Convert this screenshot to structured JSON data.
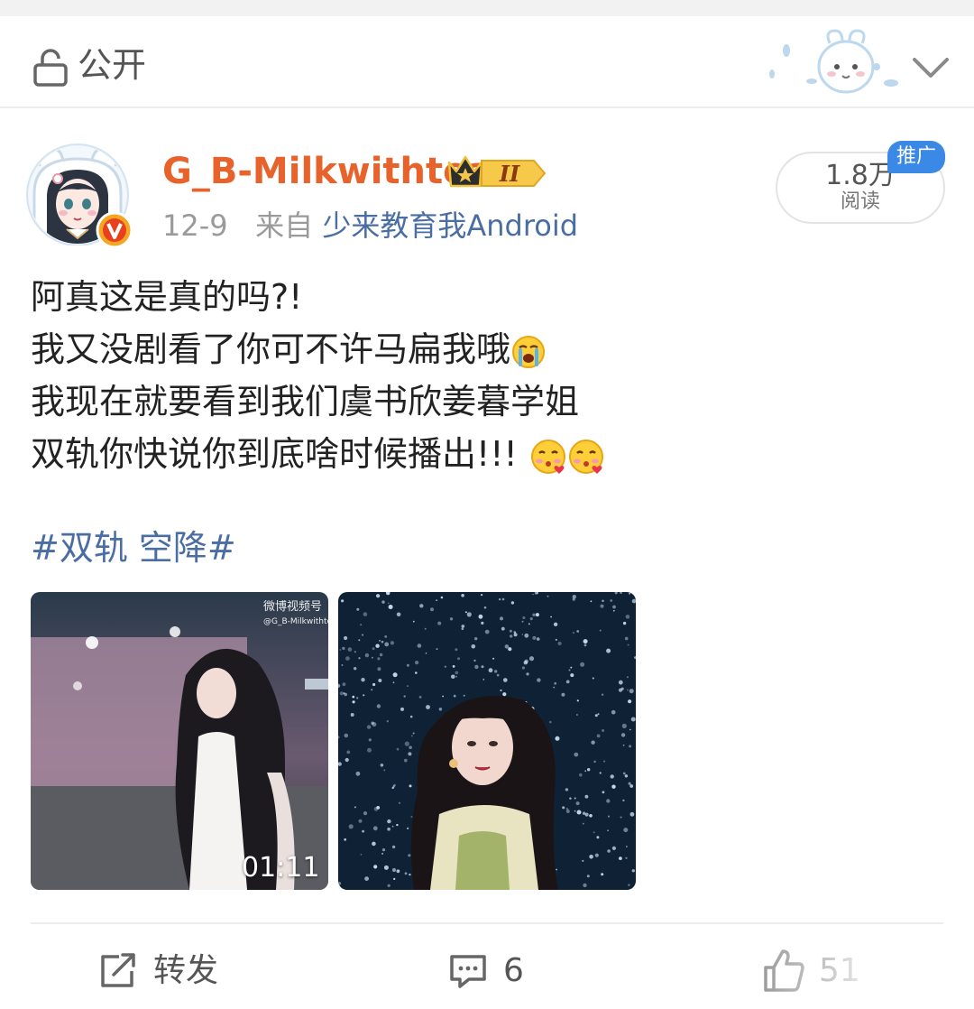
{
  "header": {
    "visibility_label": "公开",
    "icons": [
      "lock-icon",
      "decorative-bunny-sticker",
      "chevron-down-icon"
    ]
  },
  "post": {
    "username": "G_B-Milkwithtea",
    "level_badge": "II",
    "date": "12-9",
    "source_prefix": "来自",
    "source": "少来教育我Android",
    "reads_count": "1.8万",
    "reads_label": "阅读",
    "promo_badge": "推广",
    "text_lines": [
      "阿真这是真的吗?!",
      "我又没剧看了你可不许马扁我哦",
      "我现在就要看到我们虞书欣姜暮学姐",
      "双轨你快说你到底啥时候播出!!!"
    ],
    "hashtag": "#双轨 空降#",
    "media": [
      {
        "type": "video",
        "watermark": "微博视频号",
        "watermark_user": "@G_B-Milkwithtea",
        "duration": "01:11"
      },
      {
        "type": "image"
      }
    ]
  },
  "actions": {
    "repost_label": "转发",
    "comment_count": "6",
    "like_count": "51"
  },
  "colors": {
    "username": "#e8632b",
    "link": "#4a6da4",
    "promo": "#3b89e6",
    "meta": "#9a9a9a"
  }
}
